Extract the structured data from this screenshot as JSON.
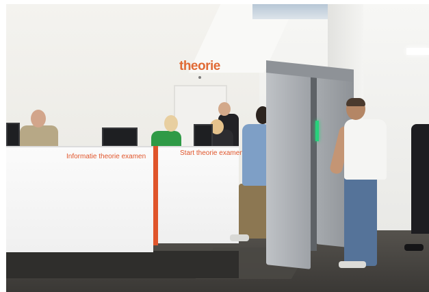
{
  "scene": {
    "wall_sign": "theorie",
    "desk_signs": {
      "left": "Informatie theorie examen",
      "right": "Start theorie examen"
    },
    "colors": {
      "brand_orange": "#e0552b",
      "sign_orange": "#e06a35",
      "desk_white": "#f5f5f5",
      "gate_grey": "#a4a8ad"
    }
  }
}
